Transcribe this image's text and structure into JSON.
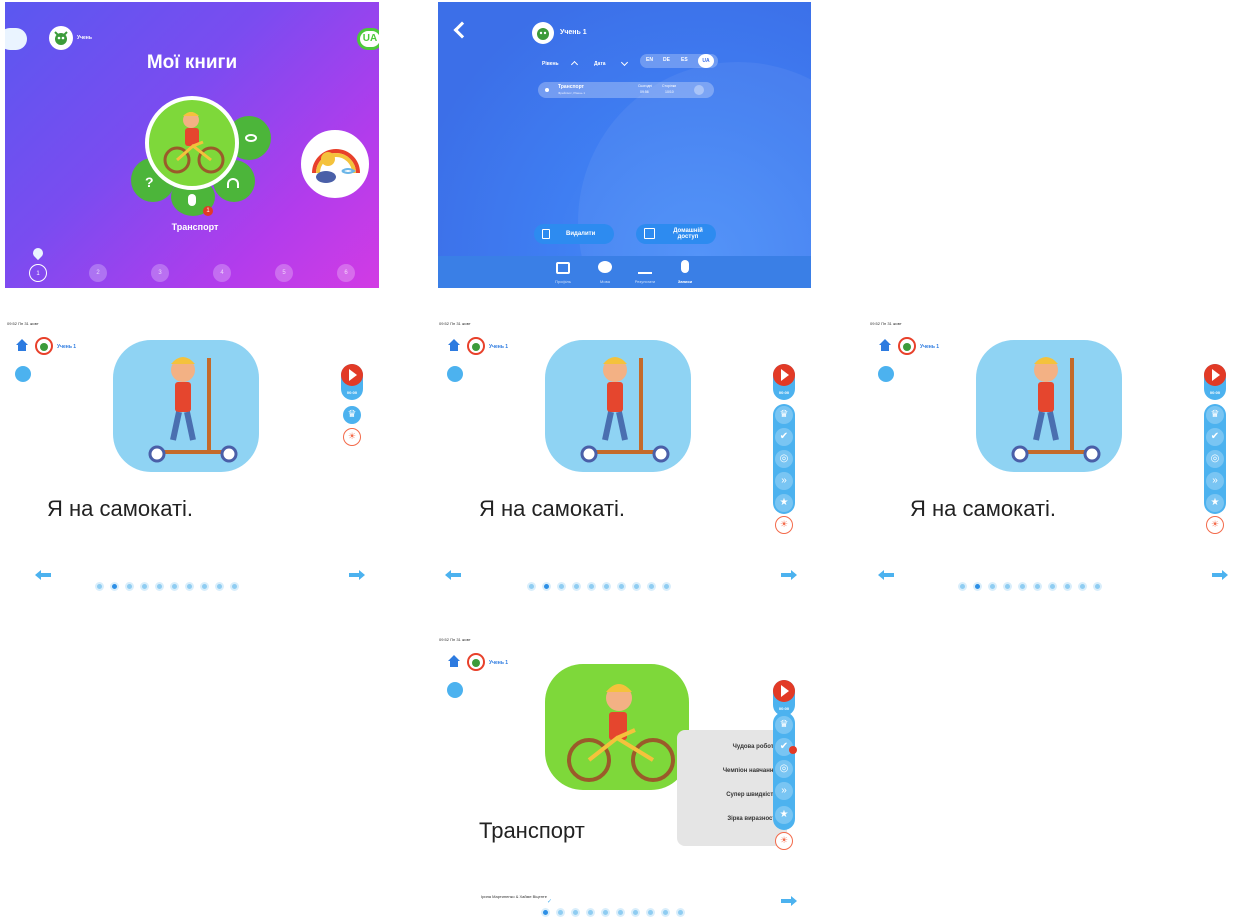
{
  "panel1": {
    "title": "Мої книги",
    "student_label": "Учень",
    "language": "UA",
    "book_label": "Транспорт",
    "badge": "1",
    "level_numbers": [
      "1",
      "2",
      "3",
      "4",
      "5",
      "6"
    ]
  },
  "panel2": {
    "student_label": "Учень 1",
    "sort_level": "Рівень",
    "sort_date": "Дата",
    "languages": [
      "EN",
      "DE",
      "ES",
      "UA"
    ],
    "row": {
      "title": "Транспорт",
      "subtitle": "Фрейпінгс, Рівень 1",
      "col1_label": "Сьогодні",
      "col1_value": "09:56",
      "col2_label": "Сторінки",
      "col2_value": "10/10"
    },
    "delete_label": "Видалити",
    "share_label": "Домашній доступ",
    "tabs": [
      "Профіль",
      "Мова",
      "Результати",
      "Записи"
    ]
  },
  "reader": {
    "student_label": "Учень 1",
    "sentence": "Я на самокаті.",
    "time": "00:00",
    "status_time": "09:52  Пн 31 жовт"
  },
  "panel6": {
    "title": "Транспорт",
    "authors": "Ірина Мартиненко & Хайме Віценте",
    "popup_items": [
      "Чудова робота",
      "Чемпіон навчання",
      "Супер швидкість",
      "Зірка виразності"
    ]
  },
  "colors": {
    "accent_blue": "#4cb2ef",
    "record_red": "#e23a26",
    "green": "#4cb53a"
  }
}
